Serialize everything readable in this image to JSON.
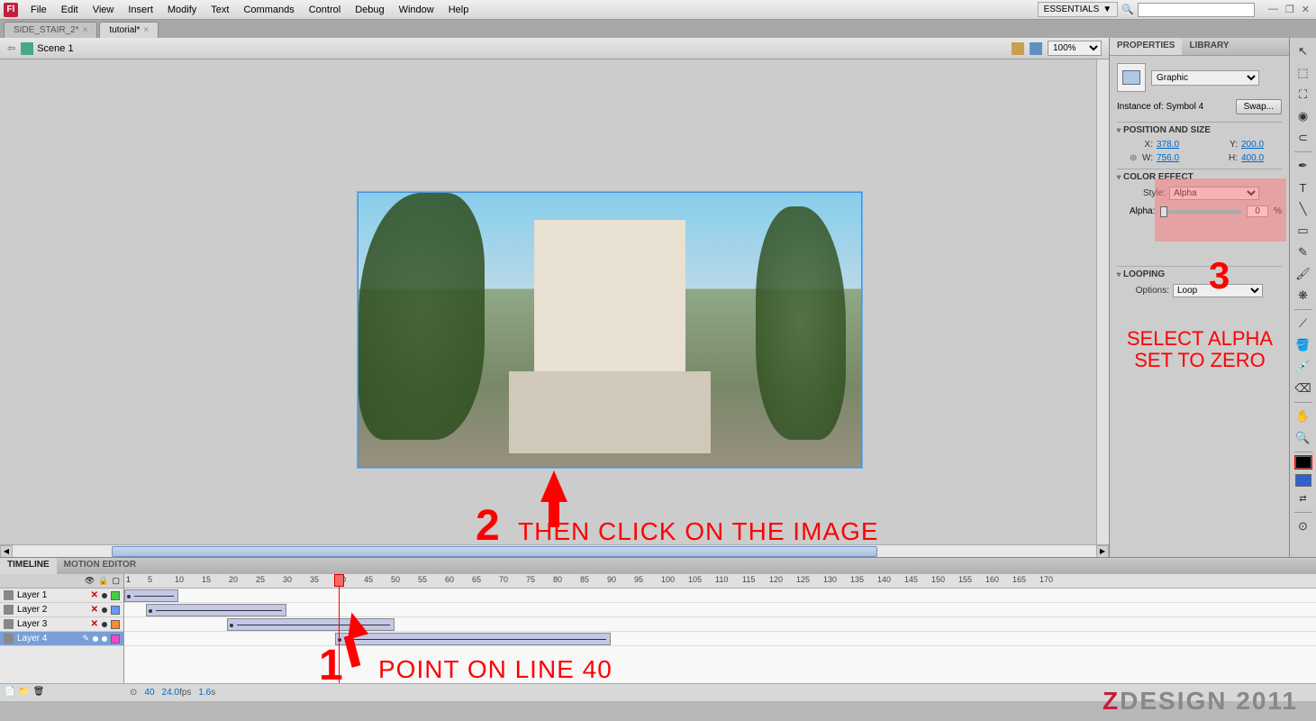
{
  "menubar": {
    "items": [
      "File",
      "Edit",
      "View",
      "Insert",
      "Modify",
      "Text",
      "Commands",
      "Control",
      "Debug",
      "Window",
      "Help"
    ],
    "workspace": "ESSENTIALS",
    "search_placeholder": ""
  },
  "doc_tabs": [
    {
      "label": "SIDE_STAIR_2*",
      "active": false
    },
    {
      "label": "tutorial*",
      "active": true
    }
  ],
  "stage": {
    "scene": "Scene 1",
    "zoom": "100%"
  },
  "annotations": {
    "step1_num": "1",
    "step1_text": "POINT ON LINE 40",
    "step2_num": "2",
    "step2_text": "THEN CLICK ON THE IMAGE",
    "step3_num": "3",
    "step3_text1": "SELECT ALPHA",
    "step3_text2": "SET TO ZERO"
  },
  "properties": {
    "tabs": [
      "PROPERTIES",
      "LIBRARY"
    ],
    "type": "Graphic",
    "instance_label": "Instance of:",
    "instance_name": "Symbol 4",
    "swap": "Swap...",
    "sections": {
      "possize": "POSITION AND SIZE",
      "coloreffect": "COLOR EFFECT",
      "looping": "LOOPING"
    },
    "x_label": "X:",
    "x": "378.0",
    "y_label": "Y:",
    "y": "200.0",
    "w_label": "W:",
    "w": "756.0",
    "h_label": "H:",
    "h": "400.0",
    "style_label": "Style:",
    "style": "Alpha",
    "alpha_label": "Alpha:",
    "alpha_value": "0",
    "alpha_unit": "%",
    "options_label": "Options:",
    "options": "Loop"
  },
  "timeline": {
    "tabs": [
      "TIMELINE",
      "MOTION EDITOR"
    ],
    "layers": [
      {
        "name": "Layer 1",
        "color": "#44cc44",
        "sel": false
      },
      {
        "name": "Layer 2",
        "color": "#6699ff",
        "sel": false
      },
      {
        "name": "Layer 3",
        "color": "#ff8833",
        "sel": false
      },
      {
        "name": "Layer 4",
        "color": "#ff44cc",
        "sel": true
      }
    ],
    "ruler": [
      1,
      5,
      10,
      15,
      20,
      25,
      30,
      35,
      40,
      45,
      50,
      55,
      60,
      65,
      70,
      75,
      80,
      85,
      90,
      95,
      100,
      105,
      110,
      115,
      120,
      125,
      130,
      135,
      140,
      145,
      150,
      155,
      160,
      165,
      170,
      1
    ],
    "tweens": [
      {
        "layer": 0,
        "start": 1,
        "end": 10
      },
      {
        "layer": 1,
        "start": 5,
        "end": 30
      },
      {
        "layer": 2,
        "start": 20,
        "end": 50
      },
      {
        "layer": 3,
        "start": 40,
        "end": 90
      }
    ],
    "playhead": 40,
    "status": {
      "frame": "40",
      "fps": "24.0",
      "fps_unit": "fps",
      "time": "1.6",
      "time_unit": "s"
    }
  },
  "watermark": {
    "z": "Z",
    "d": "DESIGN 2011"
  }
}
